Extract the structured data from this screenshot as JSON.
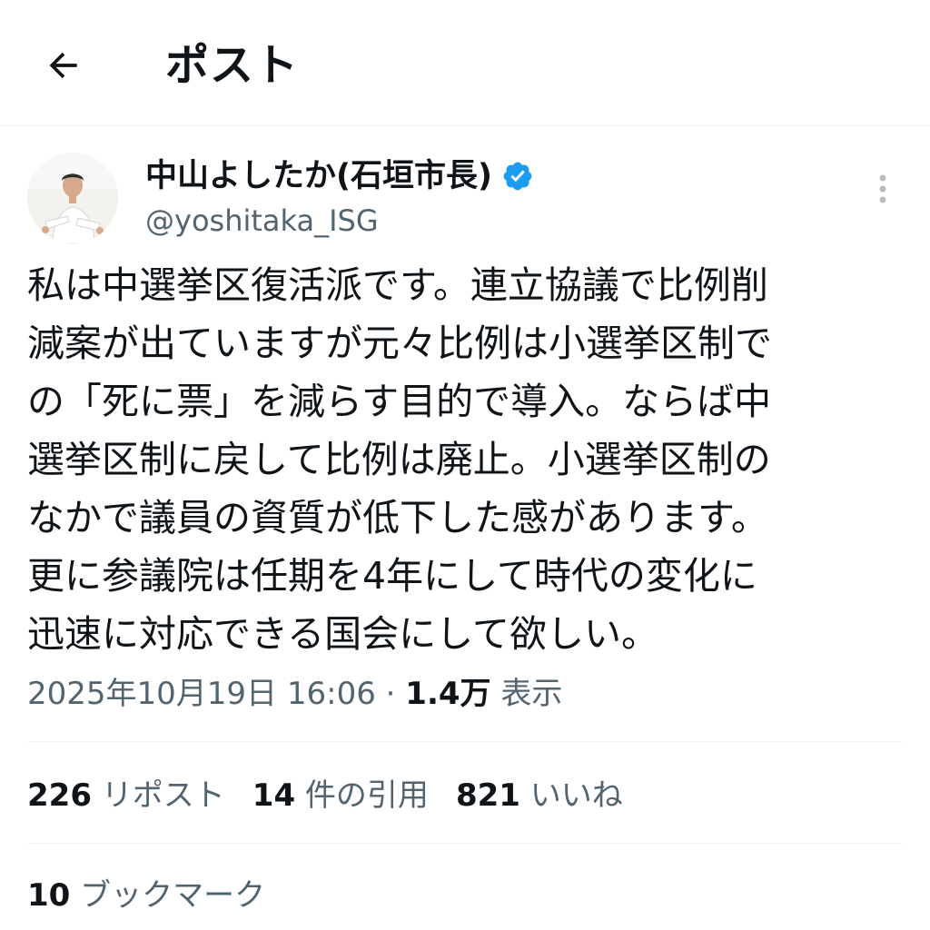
{
  "header": {
    "title": "ポスト",
    "back_icon": "arrow-left-icon"
  },
  "author": {
    "display_name": "中山よしたか(石垣市長)",
    "handle": "@yoshitaka_ISG",
    "verified_icon": "verified-badge-icon",
    "verified_color": "#1d9bf0"
  },
  "tweet": {
    "lines": [
      "私は中選挙区復活派です。連立協議で比例削",
      "減案が出ていますが元々比例は小選挙区制で",
      "の「死に票」を減らす目的で導入。ならば中",
      "選挙区制に戻して比例は廃止。小選挙区制の",
      "なかで議員の資質が低下した感があります。",
      "更に参議院は任期を4年にして時代の変化に",
      "迅速に対応できる国会にして欲しい。"
    ]
  },
  "meta": {
    "timestamp": "2025年10月19日 16:06",
    "separator": " · ",
    "views_count": "1.4万",
    "views_label": " 表示"
  },
  "stats": {
    "reposts_count": "226",
    "reposts_label": " リポスト",
    "quotes_count": "14",
    "quotes_label": " 件の引用",
    "likes_count": "821",
    "likes_label": " いいね",
    "bookmarks_count": "10",
    "bookmarks_label": " ブックマーク"
  },
  "colors": {
    "text_primary": "#0f1419",
    "text_secondary": "#536471",
    "divider": "#eff3f4"
  }
}
